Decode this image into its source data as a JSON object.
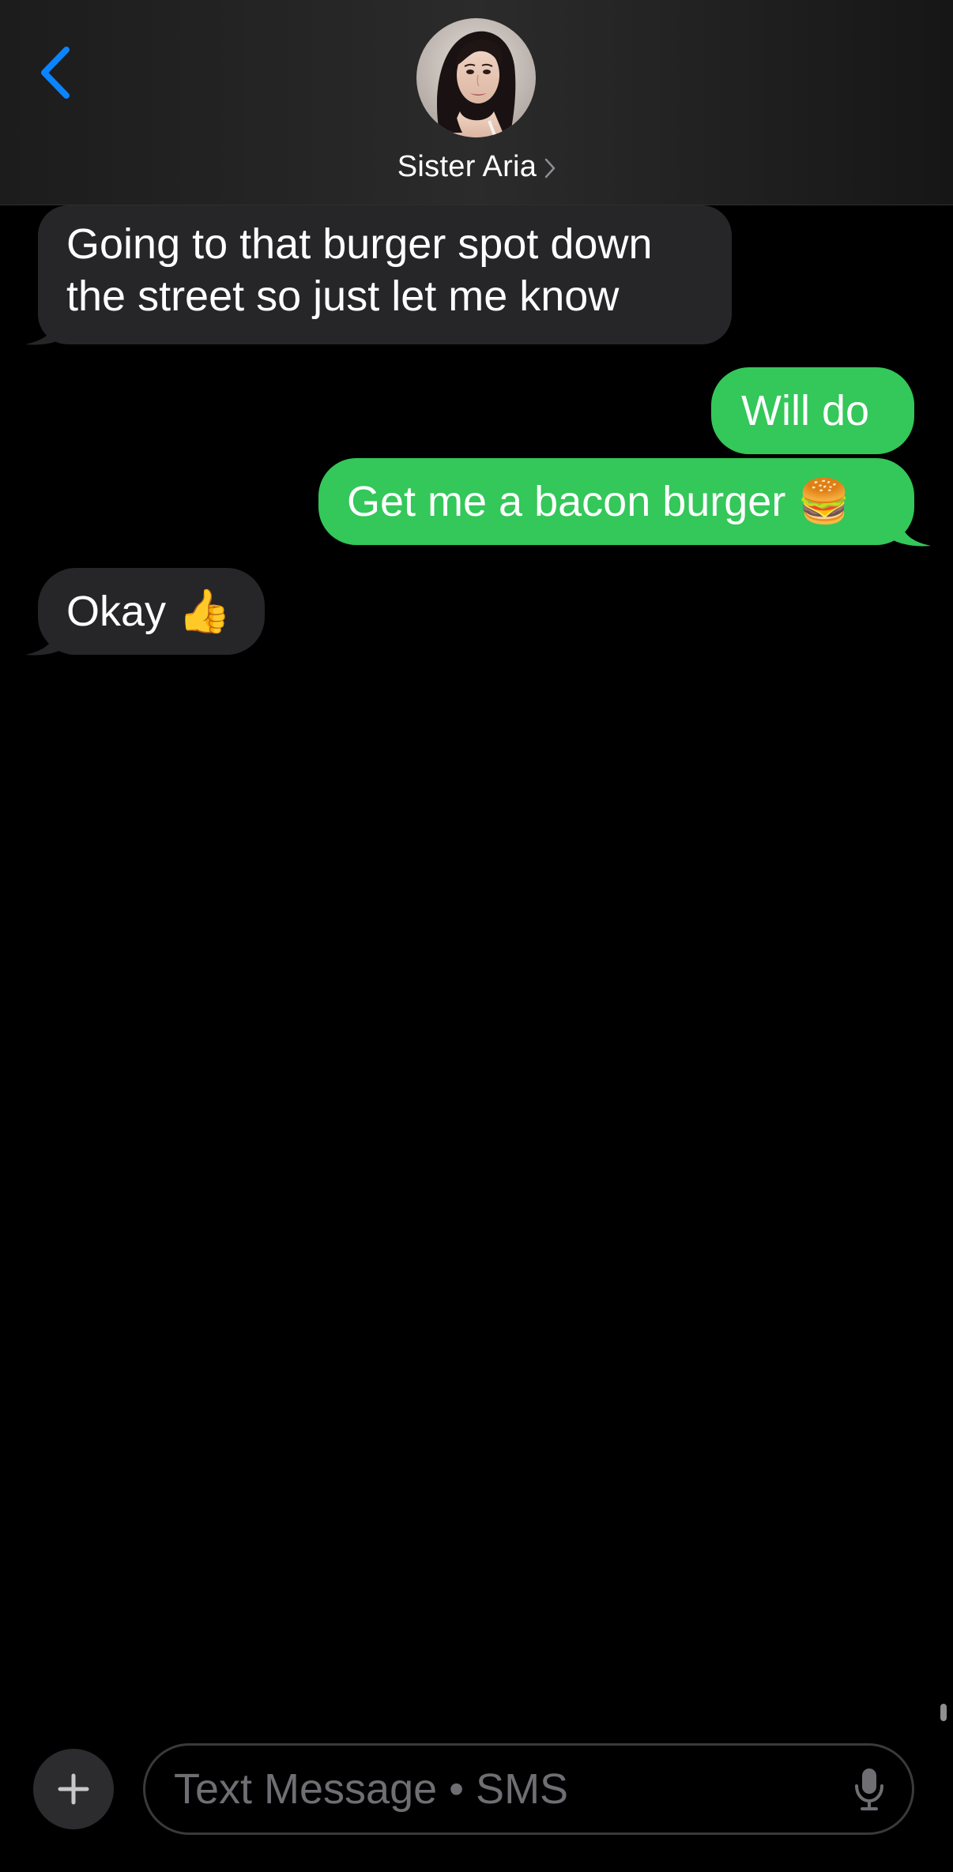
{
  "header": {
    "contact_name": "Sister Aria",
    "back_icon": "chevron-left-icon",
    "avatar_icon": "contact-avatar",
    "accent_color": "#0a84ff"
  },
  "messages": [
    {
      "direction": "incoming",
      "lines": [
        "Going to that burger spot down",
        "the street so just let me know"
      ]
    },
    {
      "direction": "outgoing",
      "text": "Will do"
    },
    {
      "direction": "outgoing",
      "text": "Get me a bacon burger",
      "emoji": "🍔"
    },
    {
      "direction": "incoming",
      "text": "Okay",
      "emoji": "👍"
    }
  ],
  "colors": {
    "incoming_bubble": "#262629",
    "outgoing_bubble": "#34c759",
    "background": "#000000"
  },
  "composer": {
    "placeholder": "Text Message • SMS",
    "value": "",
    "plus_icon": "plus-icon",
    "mic_icon": "microphone-icon"
  }
}
